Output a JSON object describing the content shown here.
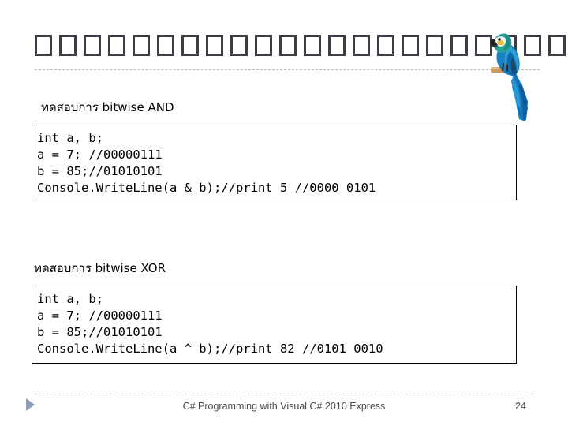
{
  "slide": {
    "title": "□□□□□□□□□□□□□□□□□□□□□□",
    "title_box_count": 22,
    "decoration": "macaw-parrot-image"
  },
  "sections": [
    {
      "caption": "ทดสอบการ bitwise AND",
      "code": [
        "int a, b;",
        "a = 7; //00000111",
        "b = 85;//01010101",
        "Console.WriteLine(a & b);//print 5 //0000 0101"
      ]
    },
    {
      "caption": "ทดสอบการ bitwise XOR",
      "code": [
        "int a, b;",
        "a = 7; //00000111",
        "b = 85;//01010101",
        "Console.WriteLine(a ^ b);//print 82 //0101 0010"
      ]
    }
  ],
  "footer": {
    "title": "C# Programming with Visual C# 2010 Express",
    "page_number": "24",
    "marker": "right-triangle"
  },
  "colors": {
    "title_text": "#3d3d45",
    "rule": "#b9bec7",
    "footer_text": "#4a4a4a",
    "triangle": "#8ba0bf",
    "code_border": "#000000",
    "parrot_body": "#1b7fc4",
    "parrot_head": "#2aa39a",
    "parrot_cheek": "#e8c33a"
  }
}
